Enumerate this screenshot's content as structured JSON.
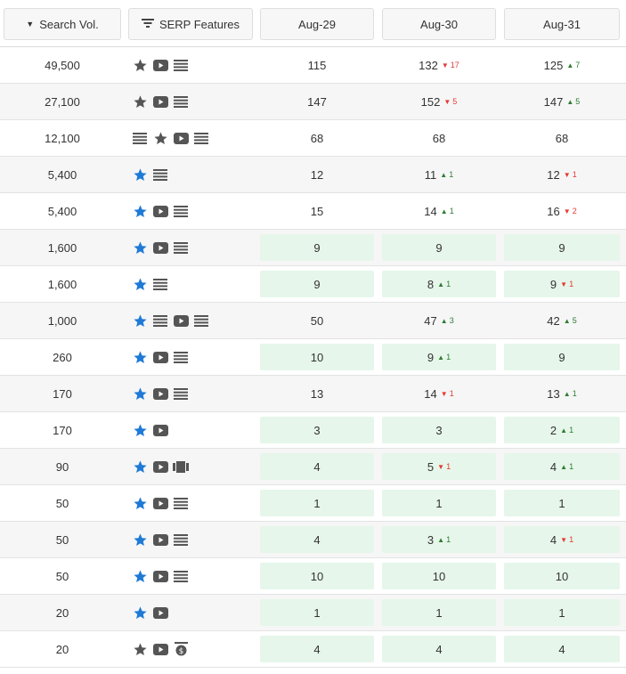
{
  "header": {
    "search_vol": "Search Vol.",
    "serp_features": "SERP Features",
    "dates": [
      "Aug-29",
      "Aug-30",
      "Aug-31"
    ]
  },
  "colors": {
    "star_blue": "#1e7ad6",
    "icon_gray": "#555555",
    "up_green": "#2e7d32",
    "down_red": "#e53935",
    "highlight": "#e6f6ea"
  },
  "rows": [
    {
      "vol": "49,500",
      "serp": [
        "star-gray",
        "video",
        "list"
      ],
      "hl": false,
      "pos": [
        {
          "v": "115",
          "d": "",
          "c": ""
        },
        {
          "v": "132",
          "d": "down",
          "c": "17"
        },
        {
          "v": "125",
          "d": "up",
          "c": "7"
        }
      ]
    },
    {
      "vol": "27,100",
      "serp": [
        "star-gray",
        "video",
        "list"
      ],
      "hl": false,
      "pos": [
        {
          "v": "147",
          "d": "",
          "c": ""
        },
        {
          "v": "152",
          "d": "down",
          "c": "5"
        },
        {
          "v": "147",
          "d": "up",
          "c": "5"
        }
      ]
    },
    {
      "vol": "12,100",
      "serp": [
        "list",
        "star-gray",
        "video",
        "list"
      ],
      "hl": false,
      "pos": [
        {
          "v": "68",
          "d": "",
          "c": ""
        },
        {
          "v": "68",
          "d": "",
          "c": ""
        },
        {
          "v": "68",
          "d": "",
          "c": ""
        }
      ]
    },
    {
      "vol": "5,400",
      "serp": [
        "star-blue",
        "list"
      ],
      "hl": false,
      "pos": [
        {
          "v": "12",
          "d": "",
          "c": ""
        },
        {
          "v": "11",
          "d": "up",
          "c": "1"
        },
        {
          "v": "12",
          "d": "down",
          "c": "1"
        }
      ]
    },
    {
      "vol": "5,400",
      "serp": [
        "star-blue",
        "video",
        "list"
      ],
      "hl": false,
      "pos": [
        {
          "v": "15",
          "d": "",
          "c": ""
        },
        {
          "v": "14",
          "d": "up",
          "c": "1"
        },
        {
          "v": "16",
          "d": "down",
          "c": "2"
        }
      ]
    },
    {
      "vol": "1,600",
      "serp": [
        "star-blue",
        "video",
        "list"
      ],
      "hl": true,
      "pos": [
        {
          "v": "9",
          "d": "",
          "c": ""
        },
        {
          "v": "9",
          "d": "",
          "c": ""
        },
        {
          "v": "9",
          "d": "",
          "c": ""
        }
      ]
    },
    {
      "vol": "1,600",
      "serp": [
        "star-blue",
        "list"
      ],
      "hl": true,
      "pos": [
        {
          "v": "9",
          "d": "",
          "c": ""
        },
        {
          "v": "8",
          "d": "up",
          "c": "1"
        },
        {
          "v": "9",
          "d": "down",
          "c": "1"
        }
      ]
    },
    {
      "vol": "1,000",
      "serp": [
        "star-blue",
        "list",
        "video",
        "list"
      ],
      "hl": false,
      "pos": [
        {
          "v": "50",
          "d": "",
          "c": ""
        },
        {
          "v": "47",
          "d": "up",
          "c": "3"
        },
        {
          "v": "42",
          "d": "up",
          "c": "5"
        }
      ]
    },
    {
      "vol": "260",
      "serp": [
        "star-blue",
        "video",
        "list"
      ],
      "hl": true,
      "pos": [
        {
          "v": "10",
          "d": "",
          "c": ""
        },
        {
          "v": "9",
          "d": "up",
          "c": "1"
        },
        {
          "v": "9",
          "d": "",
          "c": ""
        }
      ]
    },
    {
      "vol": "170",
      "serp": [
        "star-blue",
        "video",
        "list"
      ],
      "hl": false,
      "pos": [
        {
          "v": "13",
          "d": "",
          "c": ""
        },
        {
          "v": "14",
          "d": "down",
          "c": "1"
        },
        {
          "v": "13",
          "d": "up",
          "c": "1"
        }
      ]
    },
    {
      "vol": "170",
      "serp": [
        "star-blue",
        "video"
      ],
      "hl": true,
      "pos": [
        {
          "v": "3",
          "d": "",
          "c": ""
        },
        {
          "v": "3",
          "d": "",
          "c": ""
        },
        {
          "v": "2",
          "d": "up",
          "c": "1"
        }
      ]
    },
    {
      "vol": "90",
      "serp": [
        "star-blue",
        "video",
        "carousel"
      ],
      "hl": true,
      "pos": [
        {
          "v": "4",
          "d": "",
          "c": ""
        },
        {
          "v": "5",
          "d": "down",
          "c": "1"
        },
        {
          "v": "4",
          "d": "up",
          "c": "1"
        }
      ]
    },
    {
      "vol": "50",
      "serp": [
        "star-blue",
        "video",
        "list"
      ],
      "hl": true,
      "pos": [
        {
          "v": "1",
          "d": "",
          "c": ""
        },
        {
          "v": "1",
          "d": "",
          "c": ""
        },
        {
          "v": "1",
          "d": "",
          "c": ""
        }
      ]
    },
    {
      "vol": "50",
      "serp": [
        "star-blue",
        "video",
        "list"
      ],
      "hl": true,
      "pos": [
        {
          "v": "4",
          "d": "",
          "c": ""
        },
        {
          "v": "3",
          "d": "up",
          "c": "1"
        },
        {
          "v": "4",
          "d": "down",
          "c": "1"
        }
      ]
    },
    {
      "vol": "50",
      "serp": [
        "star-blue",
        "video",
        "list"
      ],
      "hl": true,
      "pos": [
        {
          "v": "10",
          "d": "",
          "c": ""
        },
        {
          "v": "10",
          "d": "",
          "c": ""
        },
        {
          "v": "10",
          "d": "",
          "c": ""
        }
      ]
    },
    {
      "vol": "20",
      "serp": [
        "star-blue",
        "video"
      ],
      "hl": true,
      "pos": [
        {
          "v": "1",
          "d": "",
          "c": ""
        },
        {
          "v": "1",
          "d": "",
          "c": ""
        },
        {
          "v": "1",
          "d": "",
          "c": ""
        }
      ]
    },
    {
      "vol": "20",
      "serp": [
        "star-gray",
        "video",
        "ads"
      ],
      "hl": true,
      "pos": [
        {
          "v": "4",
          "d": "",
          "c": ""
        },
        {
          "v": "4",
          "d": "",
          "c": ""
        },
        {
          "v": "4",
          "d": "",
          "c": ""
        }
      ]
    }
  ]
}
